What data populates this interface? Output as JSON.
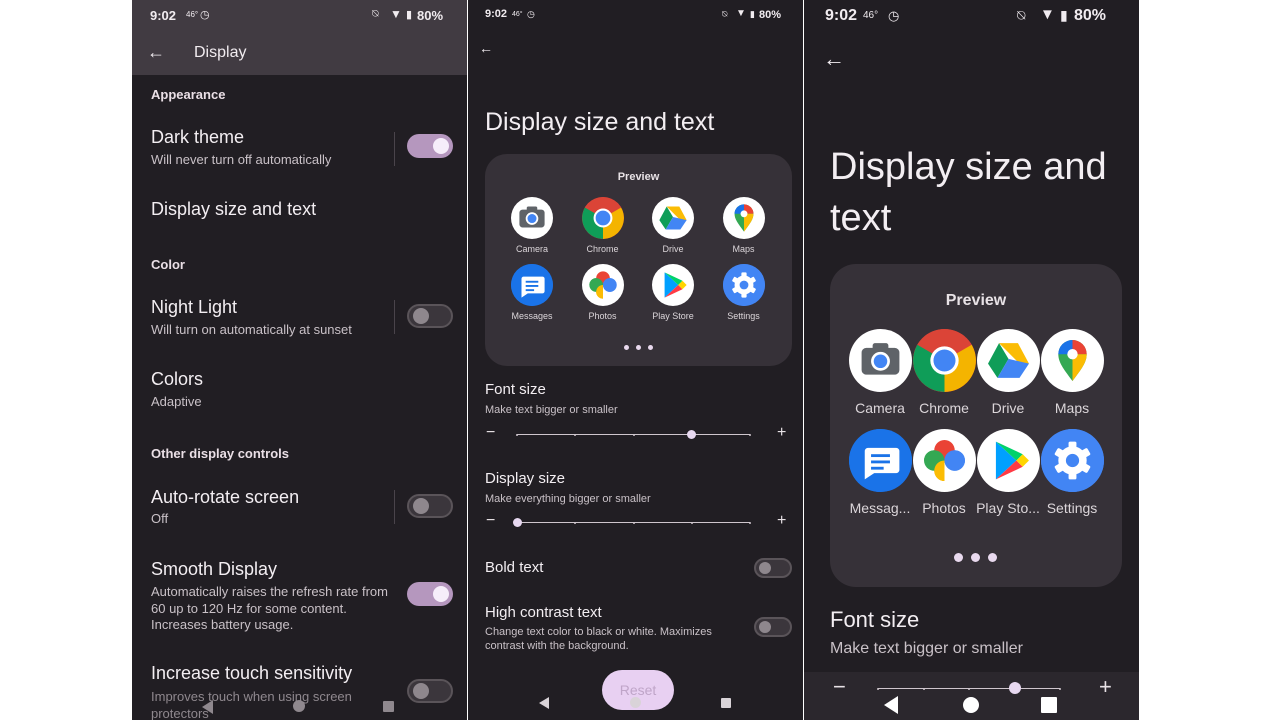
{
  "status": {
    "time": "9:02",
    "temp": "46°",
    "battery": "80%"
  },
  "screen1": {
    "title": "Display",
    "sections": {
      "appearance": "Appearance",
      "color": "Color",
      "other": "Other display controls"
    },
    "items": {
      "dark_theme": {
        "title": "Dark theme",
        "subtitle": "Will never turn off automatically",
        "on": true
      },
      "display_size": {
        "title": "Display size and text"
      },
      "night_light": {
        "title": "Night Light",
        "subtitle": "Will turn on automatically at sunset",
        "on": false
      },
      "colors": {
        "title": "Colors",
        "subtitle": "Adaptive"
      },
      "auto_rotate": {
        "title": "Auto-rotate screen",
        "subtitle": "Off",
        "on": false
      },
      "smooth_display": {
        "title": "Smooth Display",
        "subtitle": "Automatically raises the refresh rate from 60 up to 120 Hz for some content. Increases battery usage.",
        "on": true
      },
      "touch_sensitivity": {
        "title": "Increase touch sensitivity",
        "subtitle": "Improves touch when using screen protectors",
        "on": false
      }
    }
  },
  "screen2": {
    "title": "Display size and text",
    "preview": {
      "label": "Preview",
      "apps": [
        "Camera",
        "Chrome",
        "Drive",
        "Maps",
        "Messages",
        "Photos",
        "Play Store",
        "Settings"
      ]
    },
    "font_size": {
      "title": "Font size",
      "subtitle": "Make text bigger or smaller",
      "level": 3,
      "steps": 5
    },
    "display_size": {
      "title": "Display size",
      "subtitle": "Make everything bigger or smaller",
      "level": 0,
      "steps": 5
    },
    "bold_text": {
      "title": "Bold text",
      "on": false
    },
    "high_contrast": {
      "title": "High contrast text",
      "subtitle": "Change text color to black or white. Maximizes contrast with the background.",
      "on": false
    },
    "reset_label": "Reset"
  },
  "screen3": {
    "title": "Display size and text",
    "preview": {
      "label": "Preview",
      "apps": [
        "Camera",
        "Chrome",
        "Drive",
        "Maps",
        "Messag...",
        "Photos",
        "Play Sto...",
        "Settings"
      ]
    },
    "font_size": {
      "title": "Font size",
      "subtitle": "Make text bigger or smaller",
      "level": 3,
      "steps": 5
    }
  },
  "colors": {
    "background": "#211e23",
    "toggle_on": "#b597be",
    "accent_light": "#e7d8f0"
  }
}
